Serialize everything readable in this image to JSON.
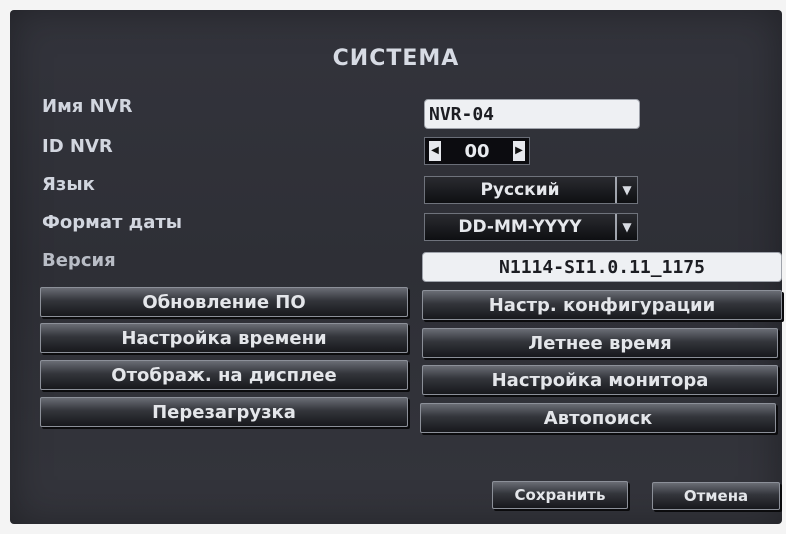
{
  "title": "СИСТЕМА",
  "fields": {
    "nvr_name_label": "Имя NVR",
    "nvr_name_value": "NVR-04",
    "nvr_id_label": "ID NVR",
    "nvr_id_value": "00",
    "language_label": "Язык",
    "language_value": "Русский",
    "date_format_label": "Формат даты",
    "date_format_value": "DD-MM-YYYY",
    "version_label": "Версия",
    "version_value": "N1114-SI1.0.11_1175"
  },
  "buttons": {
    "firmware_update": "Обновление ПО",
    "config_settings": "Настр. конфигурации",
    "time_settings": "Настройка времени",
    "daylight_saving": "Летнее время",
    "display_on_screen": "Отображ. на дисплее",
    "monitor_settings": "Настройка монитора",
    "reboot": "Перезагрузка",
    "autosearch": "Автопоиск",
    "save": "Сохранить",
    "cancel": "Отмена"
  },
  "icons": {
    "spin_left": "left-triangle-icon",
    "spin_right": "right-triangle-icon",
    "dropdown": "chevron-down-icon"
  }
}
